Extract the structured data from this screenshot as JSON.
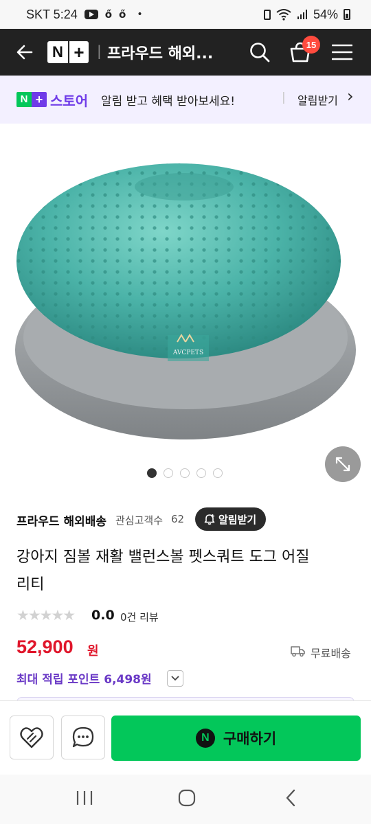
{
  "status_bar": {
    "carrier_time": "SKT 5:24",
    "notif_dot": "•",
    "battery": "54%",
    "icons": [
      "youtube-icon",
      "notification-icon",
      "notification-icon",
      "battery-saver-icon",
      "wifi-icon",
      "signal-icon",
      "battery-icon"
    ]
  },
  "header": {
    "logo_n": "N",
    "logo_plus": "+",
    "divider": "|",
    "store_title": "프라우드 해외...",
    "cart_count": "15"
  },
  "banner": {
    "logo_n": "N",
    "logo_plus": "+",
    "store_label": "스토어",
    "message": "알림 받고 혜택 받아보세요!",
    "divider": "|",
    "action": "알림받기",
    "chevron": "›"
  },
  "product_image": {
    "brand_mark": "AVCPETS",
    "slide_count": 5,
    "active_slide": 1
  },
  "seller": {
    "name": "프라우드 해외배송",
    "interest_label": "관심고객수",
    "interest_count": "62",
    "notify_label": "알림받기"
  },
  "product": {
    "title_line1": "강아지 짐볼 재활 밸런스볼 펫스쿼트 도그 어질",
    "title_line2": "리티",
    "rating": "0.0",
    "rating_stars": 0,
    "review_text": "0건 리뷰",
    "price": "52,900",
    "price_unit": "원",
    "shipping": "무료배송",
    "points_text": "최대 적립 포인트 6,498원"
  },
  "bottom_bar": {
    "buy_label": "구매하기",
    "buy_logo": "N"
  },
  "colors": {
    "header_bg": "#222222",
    "banner_bg": "#f3f0ff",
    "naver_green": "#03c75a",
    "price_red": "#e0162b",
    "points_purple": "#6a39c6",
    "badge_red": "#ff4b3e"
  }
}
